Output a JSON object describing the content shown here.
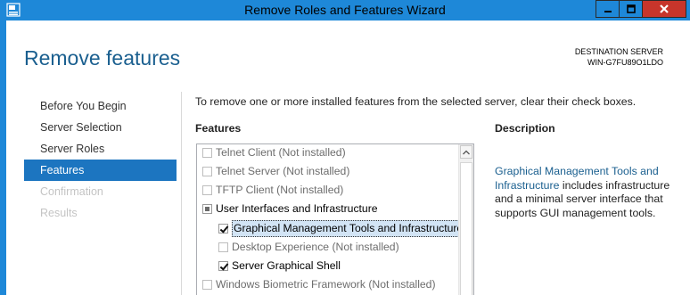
{
  "window": {
    "title": "Remove Roles and Features Wizard",
    "icon": "server-manager-icon",
    "controls": [
      "minimize-icon",
      "maximize-icon",
      "close-icon"
    ],
    "colors": {
      "frame": "#1E88D8",
      "close": "#C7352B",
      "accent": "#1C75C0"
    }
  },
  "page": {
    "heading": "Remove features",
    "destination_label": "DESTINATION SERVER",
    "destination_server": "WIN-G7FU89O1LDO"
  },
  "nav": {
    "items": [
      {
        "label": "Before You Begin",
        "state": "normal"
      },
      {
        "label": "Server Selection",
        "state": "normal"
      },
      {
        "label": "Server Roles",
        "state": "normal"
      },
      {
        "label": "Features",
        "state": "active"
      },
      {
        "label": "Confirmation",
        "state": "disabled"
      },
      {
        "label": "Results",
        "state": "disabled"
      }
    ]
  },
  "main": {
    "intro": "To remove one or more installed features from the selected server, clear their check boxes.",
    "features_label": "Features",
    "features": [
      {
        "label": "Telnet Client (Not installed)",
        "checked": "none",
        "dim": true,
        "indent": 0
      },
      {
        "label": "Telnet Server (Not installed)",
        "checked": "none",
        "dim": true,
        "indent": 0
      },
      {
        "label": "TFTP Client (Not installed)",
        "checked": "none",
        "dim": true,
        "indent": 0
      },
      {
        "label": "User Interfaces and Infrastructure",
        "checked": "partial",
        "dim": false,
        "indent": 0
      },
      {
        "label": "Graphical Management Tools and Infrastructure",
        "checked": "checked",
        "dim": false,
        "indent": 1,
        "selected": true
      },
      {
        "label": "Desktop Experience (Not installed)",
        "checked": "none",
        "dim": true,
        "indent": 1
      },
      {
        "label": "Server Graphical Shell",
        "checked": "checked",
        "dim": false,
        "indent": 1
      },
      {
        "label": "Windows Biometric Framework (Not installed)",
        "checked": "none",
        "dim": true,
        "indent": 0
      }
    ]
  },
  "description": {
    "label": "Description",
    "link": "Graphical Management Tools and Infrastructure",
    "text": " includes infrastructure and a minimal server interface that supports GUI management tools."
  }
}
